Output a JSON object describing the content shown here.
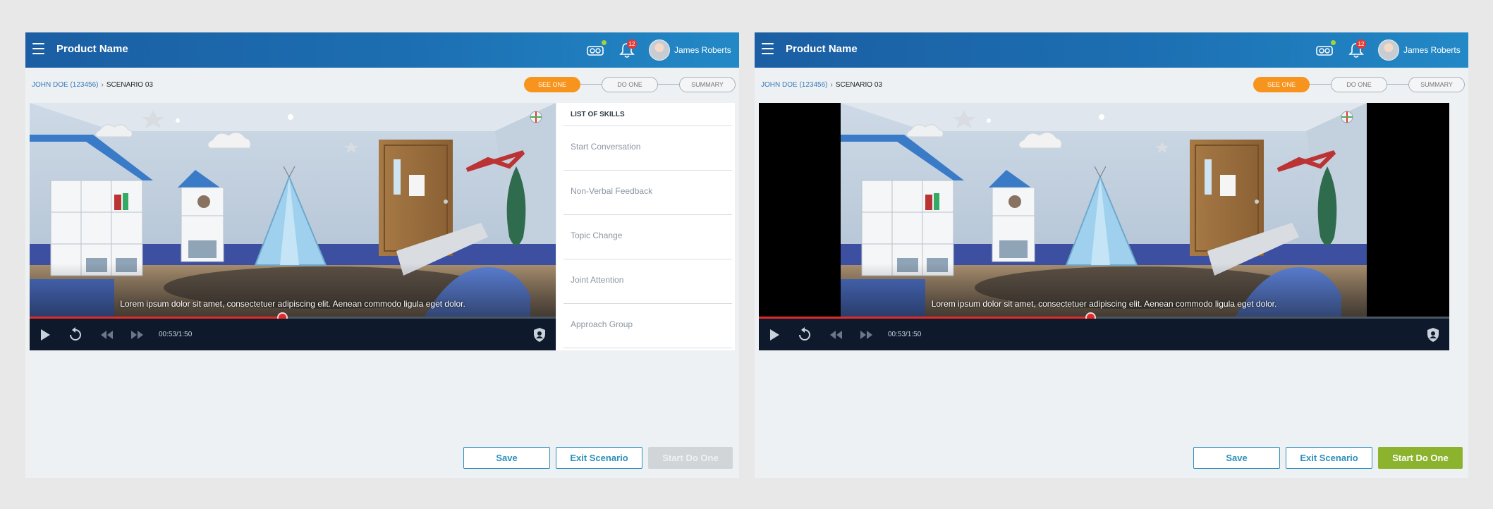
{
  "colors": {
    "appbar_start": "#1b5ea3",
    "appbar_end": "#2389c6",
    "step_active": "#f7941d",
    "progress": "#e02b2b",
    "button_outline": "#2c8fbd",
    "button_primary": "#8cb32e",
    "button_disabled": "#d2d5d8"
  },
  "header": {
    "menu_icon": "hamburger-menu-icon",
    "title": "Product Name",
    "vr_icon": "vr-headset-icon",
    "notification_icon": "bell-icon",
    "notification_count": "12",
    "user_name": "James Roberts"
  },
  "breadcrumb": {
    "patient": "JOHN DOE (123456)",
    "separator_icon": "chevron-right-icon",
    "scenario": "SCENARIO 03"
  },
  "stepper": {
    "steps": [
      "SEE ONE",
      "DO ONE",
      "SUMMARY"
    ],
    "active_index": 0
  },
  "player": {
    "caption": "Lorem ipsum dolor sit amet, consectetuer adipiscing elit. Aenean commodo ligula eget dolor.",
    "time": "00:53/1:50",
    "progress_fraction": 0.48,
    "controls": [
      "play-icon",
      "replay-icon",
      "rewind-icon",
      "fast-forward-icon",
      "shield-user-icon"
    ]
  },
  "skills": {
    "header": "LIST OF SKILLS",
    "items": [
      "Start Conversation",
      "Non-Verbal Feedback",
      "Topic Change",
      "Joint Attention",
      "Approach Group"
    ]
  },
  "buttons": {
    "save": "Save",
    "exit": "Exit Scenario",
    "start": "Start Do One"
  },
  "panels": {
    "left_start_enabled": false,
    "right_start_enabled": true
  }
}
